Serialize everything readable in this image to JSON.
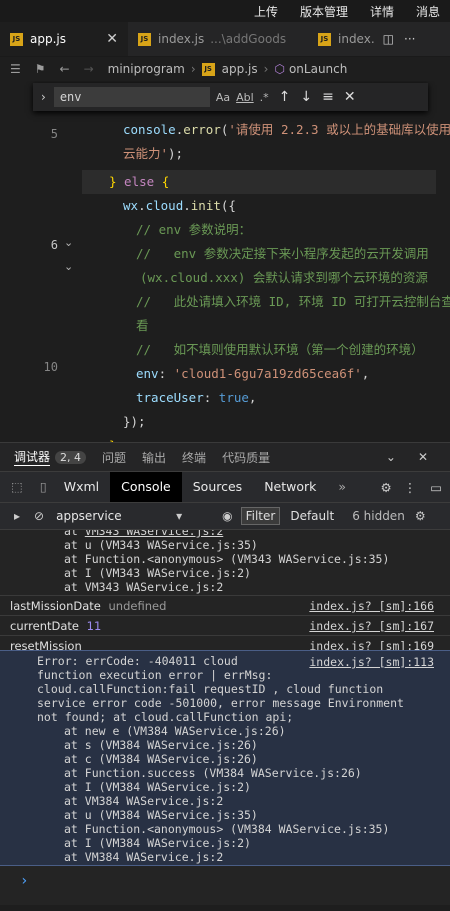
{
  "menu": [
    "上传",
    "版本管理",
    "详情",
    "消息"
  ],
  "editor_tabs": [
    {
      "label": "app.js",
      "active": true
    },
    {
      "label": "index.js",
      "detail": "...\\addGoods"
    },
    {
      "label": "index."
    }
  ],
  "breadcrumb": [
    "miniprogram",
    "app.js",
    "onLaunch"
  ],
  "find": {
    "value": "env",
    "match_case": "Aa",
    "whole_word": "Abl"
  },
  "code": {
    "lines": [
      {
        "num": "5",
        "text": "console.error('请使用 2.2.3 或以上的基础库以使用"
      },
      {
        "num": "",
        "text": "云能力');"
      },
      {
        "num": "6",
        "text": "} else {"
      },
      {
        "num": "",
        "text": "wx.cloud.init({"
      },
      {
        "num": "",
        "text": "// env 参数说明："
      },
      {
        "num": "",
        "text": "//   env 参数决定接下来小程序发起的云开发调用"
      },
      {
        "num": "",
        "text": "(wx.cloud.xxx) 会默认请求到哪个云环境的资源"
      },
      {
        "num": "10",
        "text": "//   此处请填入环境 ID, 环境 ID 可打开云控制台查"
      },
      {
        "num": "",
        "text": "看"
      },
      {
        "num": "",
        "text": "//   如不填则使用默认环境（第一个创建的环境）"
      },
      {
        "num": "",
        "text": "env: 'cloud1-6gu7a19zd65cea6f',"
      },
      {
        "num": "",
        "text": "traceUser: true,"
      },
      {
        "num": "",
        "text": "});"
      },
      {
        "num": "",
        "text": "}"
      }
    ]
  },
  "devtools": {
    "panel_title": "调试器",
    "badge": "2, 4",
    "panel_tabs": [
      "问题",
      "输出",
      "终端",
      "代码质量"
    ],
    "tabs": [
      "Wxml",
      "Console",
      "Sources",
      "Network"
    ],
    "context": "appservice",
    "filter_label": "Filter",
    "level": "Default",
    "hidden": "6 hidden"
  },
  "console": {
    "stack_top": [
      "at u (VM343 WAService.js:35)",
      "at Function.<anonymous> (VM343 WAService.js:35)",
      "at I (VM343 WAService.js:2)",
      "at VM343 WAService.js:2"
    ],
    "logs": [
      {
        "label": "lastMissionDate",
        "value": "undefined",
        "src": "index.js? [sm]:166"
      },
      {
        "label": "currentDate",
        "value": "11",
        "src": "index.js? [sm]:167"
      },
      {
        "label": "resetMission",
        "value": "",
        "src": "index.js? [sm]:169"
      }
    ],
    "error": {
      "src": "index.js? [sm]:113",
      "message": [
        "Error: errCode: -404011 cloud",
        "function execution error | errMsg:",
        "cloud.callFunction:fail requestID , cloud function",
        "service error code -501000, error message Environment",
        "not found; at cloud.callFunction api;"
      ],
      "stack": [
        "at new e (VM384 WAService.js:26)",
        "at s (VM384 WAService.js:26)",
        "at c (VM384 WAService.js:26)",
        "at Function.success (VM384 WAService.js:26)",
        "at I (VM384 WAService.js:2)",
        "at VM384 WAService.js:2",
        "at u (VM384 WAService.js:35)",
        "at Function.<anonymous> (VM384 WAService.js:35)",
        "at I (VM384 WAService.js:2)",
        "at VM384 WAService.js:2"
      ]
    },
    "prompt": "›"
  }
}
